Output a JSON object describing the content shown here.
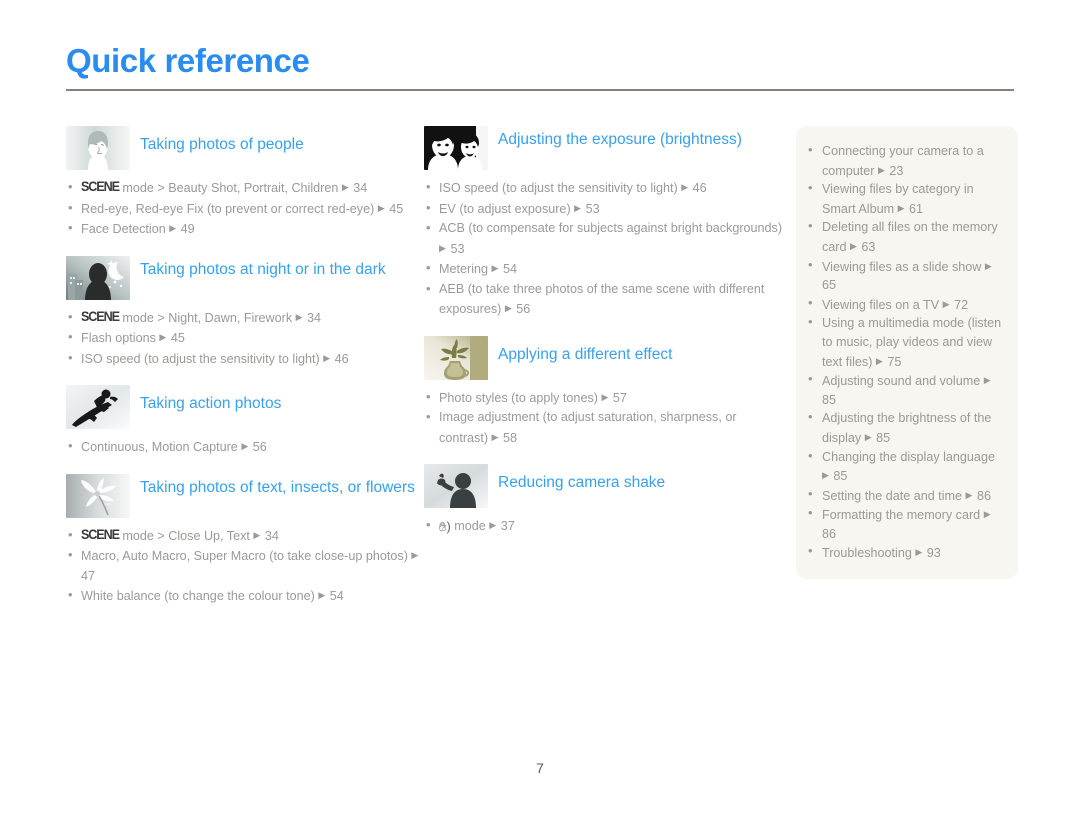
{
  "document": {
    "title": "Quick reference",
    "page_number": "7",
    "accent_color": "#2b8cf0",
    "heading_color": "#38a0ee",
    "body_color": "#9a9a96",
    "rule_color": "#8d7f78",
    "sidebox_color": "#f7f6f0"
  },
  "columns": {
    "left": [
      {
        "icon": "portrait-woman-thumbnail",
        "title": "Taking photos of people",
        "items": [
          {
            "prefix": "SCENE",
            "text": "mode > Beauty Shot, Portrait, Children",
            "page": "34"
          },
          {
            "prefix": "",
            "text": "Red-eye, Red-eye Fix (to prevent or correct red-eye)",
            "page": "45"
          },
          {
            "prefix": "",
            "text": "Face Detection",
            "page": "49"
          }
        ]
      },
      {
        "icon": "night-city-moon-thumbnail",
        "title": "Taking photos at night or in the dark",
        "items": [
          {
            "prefix": "SCENE",
            "text": "mode > Night, Dawn, Firework",
            "page": "34"
          },
          {
            "prefix": "",
            "text": "Flash options",
            "page": "45"
          },
          {
            "prefix": "",
            "text": "ISO speed (to adjust the sensitivity to light)",
            "page": "46"
          }
        ]
      },
      {
        "icon": "snowboarder-thumbnail",
        "title": "Taking action photos",
        "items": [
          {
            "prefix": "",
            "text": "Continuous, Motion Capture",
            "page": "56"
          }
        ]
      },
      {
        "icon": "flower-thumbnail",
        "title": "Taking photos of text, insects, or flowers",
        "items": [
          {
            "prefix": "SCENE",
            "text": "mode > Close Up, Text",
            "page": "34"
          },
          {
            "prefix": "",
            "text": "Macro, Auto Macro, Super Macro (to take close-up photos)",
            "page": "47"
          },
          {
            "prefix": "",
            "text": "White balance (to change the colour tone)",
            "page": "54"
          }
        ]
      }
    ],
    "middle": [
      {
        "icon": "two-faces-high-contrast-thumbnail",
        "title": "Adjusting the exposure (brightness)",
        "items": [
          {
            "prefix": "",
            "text": "ISO speed (to adjust the sensitivity to light)",
            "page": "46"
          },
          {
            "prefix": "",
            "text": "EV (to adjust exposure)",
            "page": "53"
          },
          {
            "prefix": "",
            "text": "ACB (to compensate for subjects against bright backgrounds)",
            "page": "53"
          },
          {
            "prefix": "",
            "text": "Metering",
            "page": "54"
          },
          {
            "prefix": "",
            "text": "AEB (to take three photos of the same scene with different exposures)",
            "page": "56"
          }
        ]
      },
      {
        "icon": "vase-plant-sepia-thumbnail",
        "title": "Applying a different effect",
        "items": [
          {
            "prefix": "",
            "text": "Photo styles (to apply tones)",
            "page": "57"
          },
          {
            "prefix": "",
            "text": "Image adjustment (to adjust saturation, sharpness, or contrast)",
            "page": "58"
          }
        ]
      },
      {
        "icon": "person-waving-thumbnail",
        "title": "Reducing camera shake",
        "items": [
          {
            "prefix": "HAND",
            "text": "mode",
            "page": "37"
          }
        ]
      }
    ],
    "right": {
      "items": [
        {
          "text": "Connecting your camera to a computer",
          "page": "23"
        },
        {
          "text": "Viewing files by category in Smart Album",
          "page": "61"
        },
        {
          "text": "Deleting all files on the memory card",
          "page": "63"
        },
        {
          "text": "Viewing files as a slide show",
          "page": "65"
        },
        {
          "text": "Viewing files on a TV",
          "page": "72"
        },
        {
          "text": "Using a multimedia mode (listen to music, play videos and view text files)",
          "page": "75"
        },
        {
          "text": "Adjusting sound and volume",
          "page": "85"
        },
        {
          "text": "Adjusting the brightness of the display",
          "page": "85"
        },
        {
          "text": "Changing the display language",
          "page": "85"
        },
        {
          "text": "Setting the date and time",
          "page": "86"
        },
        {
          "text": "Formatting the memory card",
          "page": "86"
        },
        {
          "text": "Troubleshooting",
          "page": "93"
        }
      ]
    }
  }
}
